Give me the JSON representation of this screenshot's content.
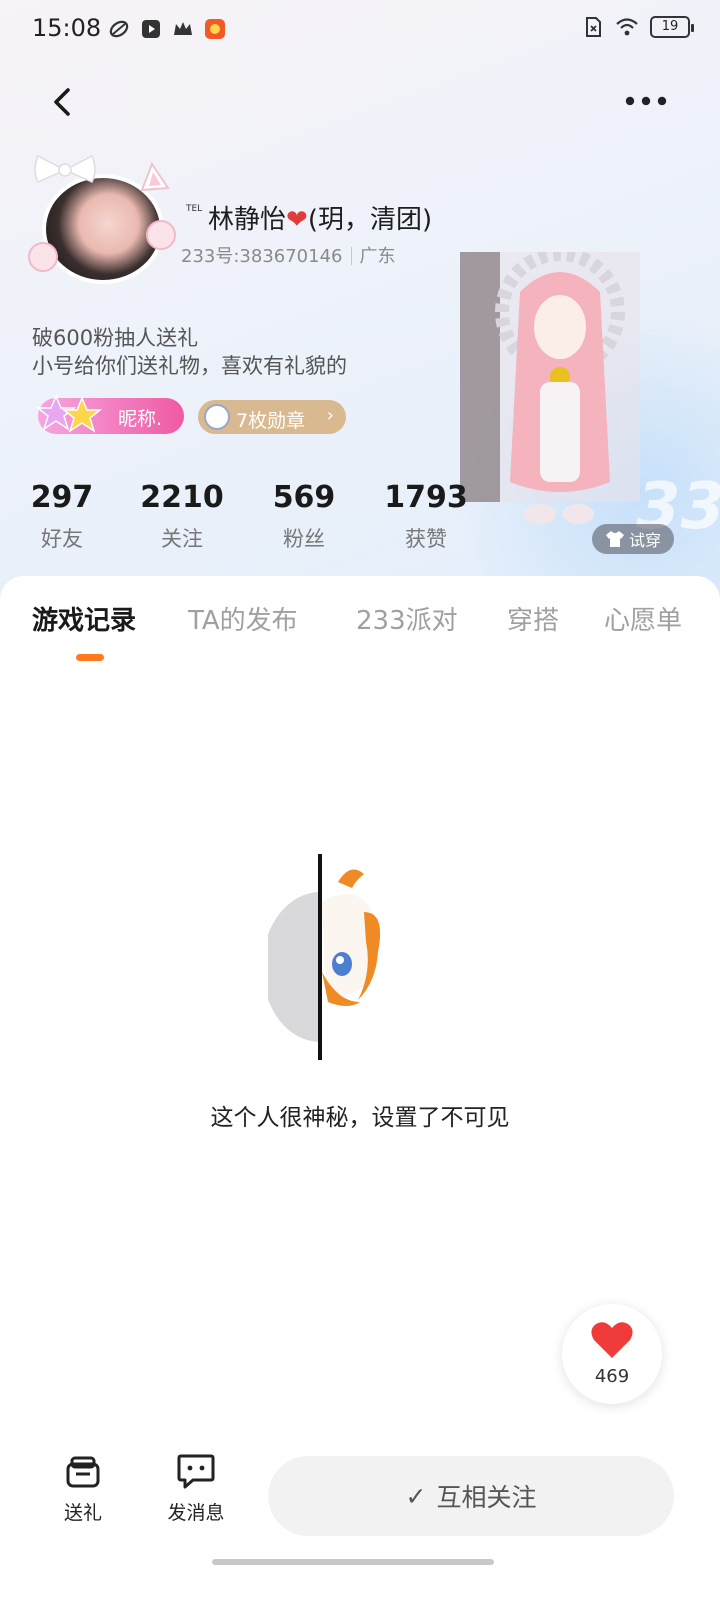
{
  "status_bar": {
    "time": "15:08",
    "battery": "19",
    "left_icons": [
      "leaf-app-icon",
      "video-app-icon",
      "crown-app-icon",
      "game-app-icon"
    ],
    "right_icons": [
      "sim-card-icon",
      "wifi-icon",
      "battery-icon"
    ]
  },
  "profile": {
    "tel_badge": "TEL",
    "nickname_pre": "林静怡",
    "nickname_heart": "❤",
    "nickname_post": "(玥，清团)",
    "id_text": "233号:383670146",
    "location": "广东",
    "bio_line1": "破600粉抽人送礼",
    "bio_line2": "小号给你们送礼物，喜欢有礼貌的",
    "nickname_badge": "昵称.",
    "medal_badge": "7枚勋章",
    "medal_chevron": "›",
    "try_on": "试穿"
  },
  "stats": [
    {
      "value": "297",
      "label": "好友"
    },
    {
      "value": "2210",
      "label": "关注"
    },
    {
      "value": "569",
      "label": "粉丝"
    },
    {
      "value": "1793",
      "label": "获赞"
    }
  ],
  "tabs": [
    {
      "label": "游戏记录",
      "active": true
    },
    {
      "label": "TA的发布",
      "active": false
    },
    {
      "label": "233派对",
      "active": false
    },
    {
      "label": "穿搭",
      "active": false
    },
    {
      "label": "心愿单",
      "active": false
    }
  ],
  "empty_state": {
    "message": "这个人很神秘，设置了不可见"
  },
  "like_float": {
    "count": "469"
  },
  "bottom_bar": {
    "gift_label": "送礼",
    "message_label": "发消息",
    "follow_check": "✓",
    "follow_label": "互相关注"
  },
  "colors": {
    "accent_orange": "#ff7a1f",
    "heart_red": "#e23b3b",
    "nick_badge_pink": "#ef5aa3",
    "medal_gold": "#d9b98f"
  }
}
